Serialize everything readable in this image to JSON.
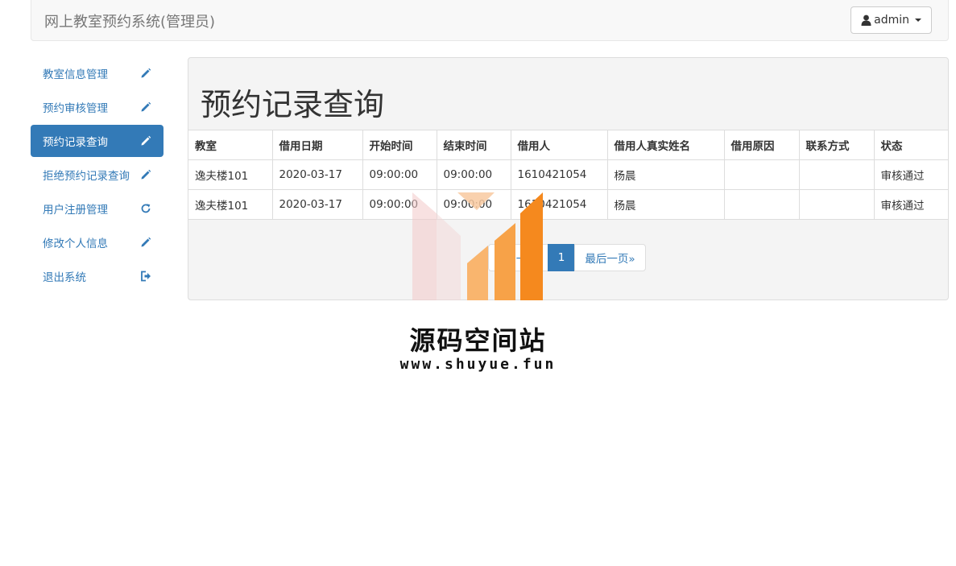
{
  "navbar": {
    "brand": "网上教室预约系统(管理员)",
    "user": "admin"
  },
  "sidebar": {
    "items": [
      {
        "label": "教室信息管理",
        "icon": "pencil-icon",
        "active": false
      },
      {
        "label": "预约审核管理",
        "icon": "pencil-icon",
        "active": false
      },
      {
        "label": "预约记录查询",
        "icon": "pencil-icon",
        "active": true
      },
      {
        "label": "拒绝预约记录查询",
        "icon": "pencil-icon",
        "active": false
      },
      {
        "label": "用户注册管理",
        "icon": "refresh-icon",
        "active": false
      },
      {
        "label": "修改个人信息",
        "icon": "pencil-icon",
        "active": false
      },
      {
        "label": "退出系统",
        "icon": "logout-icon",
        "active": false
      }
    ]
  },
  "main": {
    "title": "预约记录查询",
    "table": {
      "headers": [
        "教室",
        "借用日期",
        "开始时间",
        "结束时间",
        "借用人",
        "借用人真实姓名",
        "借用原因",
        "联系方式",
        "状态"
      ],
      "rows": [
        [
          "逸夫楼101",
          "2020-03-17",
          "09:00:00",
          "09:00:00",
          "1610421054",
          "杨晨",
          "",
          "",
          "审核通过"
        ],
        [
          "逸夫楼101",
          "2020-03-17",
          "09:00:00",
          "09:00:00",
          "1610421054",
          "杨晨",
          "",
          "",
          "审核通过"
        ]
      ]
    },
    "pagination": {
      "first": "«第一页",
      "current": "1",
      "last": "最后一页»"
    }
  },
  "watermark": {
    "title": "源码空间站",
    "url": "www.shuyue.fun"
  },
  "colors": {
    "primary": "#337ab7",
    "watermark_orange": "#f5891e"
  }
}
